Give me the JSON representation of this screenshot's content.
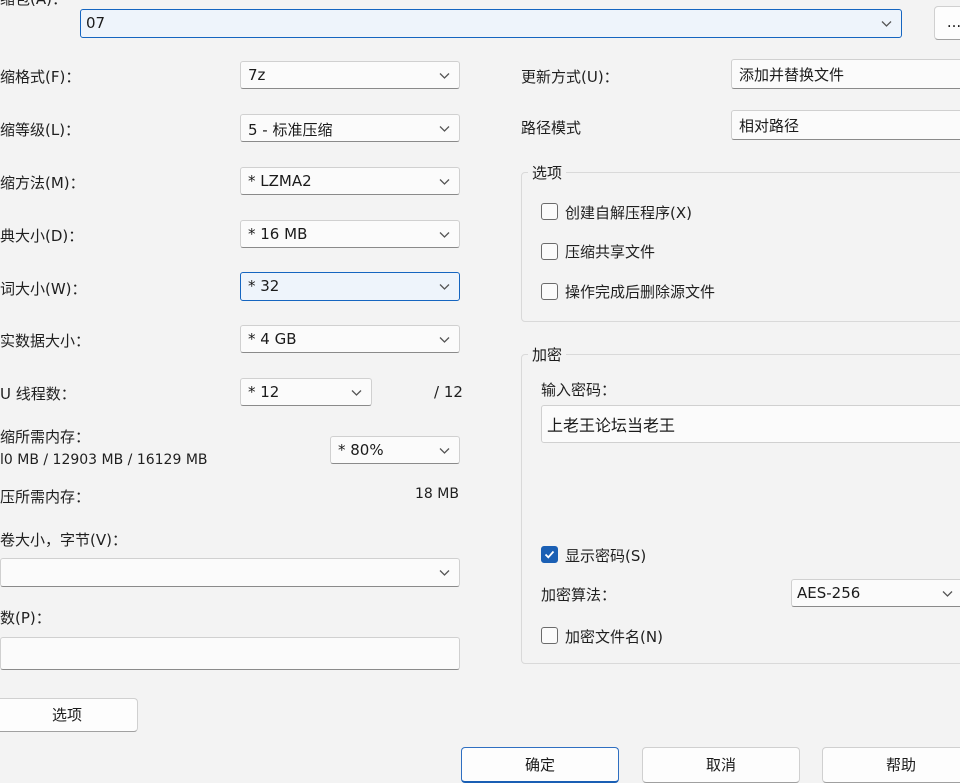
{
  "archive": {
    "label": "缩包(A)：",
    "value": "07",
    "browse_label": "..."
  },
  "left": {
    "format": {
      "label": "缩格式(F)：",
      "value": "7z"
    },
    "level": {
      "label": "缩等级(L)：",
      "value": "5 - 标准压缩"
    },
    "method": {
      "label": "缩方法(M)：",
      "value": "* LZMA2"
    },
    "dict": {
      "label": "典大小(D)：",
      "value": "* 16 MB"
    },
    "word": {
      "label": "词大小(W)：",
      "value": "* 32"
    },
    "solid": {
      "label": "实数据大小：",
      "value": "* 4 GB"
    },
    "threads": {
      "label": "U 线程数：",
      "value": "* 12",
      "max": "/ 12"
    },
    "mem_compress": {
      "label": "缩所需内存：",
      "detail": "l0 MB / 12903 MB / 16129 MB",
      "value": "* 80%"
    },
    "mem_decompress": {
      "label": "压所需内存：",
      "value": "18 MB"
    },
    "volume": {
      "label": "卷大小，字节(V)：",
      "value": ""
    },
    "params": {
      "label": "数(P)：",
      "value": ""
    },
    "options_button": "选项"
  },
  "right": {
    "update_mode": {
      "label": "更新方式(U)：",
      "value": "添加并替换文件"
    },
    "path_mode": {
      "label": "路径模式",
      "value": "相对路径"
    },
    "options_group": {
      "title": "选项",
      "items": [
        {
          "label": "创建自解压程序(X)",
          "checked": false
        },
        {
          "label": "压缩共享文件",
          "checked": false
        },
        {
          "label": "操作完成后删除源文件",
          "checked": false
        }
      ]
    },
    "encryption": {
      "title": "加密",
      "password_label": "输入密码：",
      "password_value": "上老王论坛当老王",
      "show_password": {
        "label": "显示密码(S)",
        "checked": true
      },
      "method_label": "加密算法：",
      "method_value": "AES-256",
      "encrypt_names": {
        "label": "加密文件名(N)",
        "checked": false
      }
    }
  },
  "footer": {
    "ok": "确定",
    "cancel": "取消",
    "help": "帮助"
  }
}
